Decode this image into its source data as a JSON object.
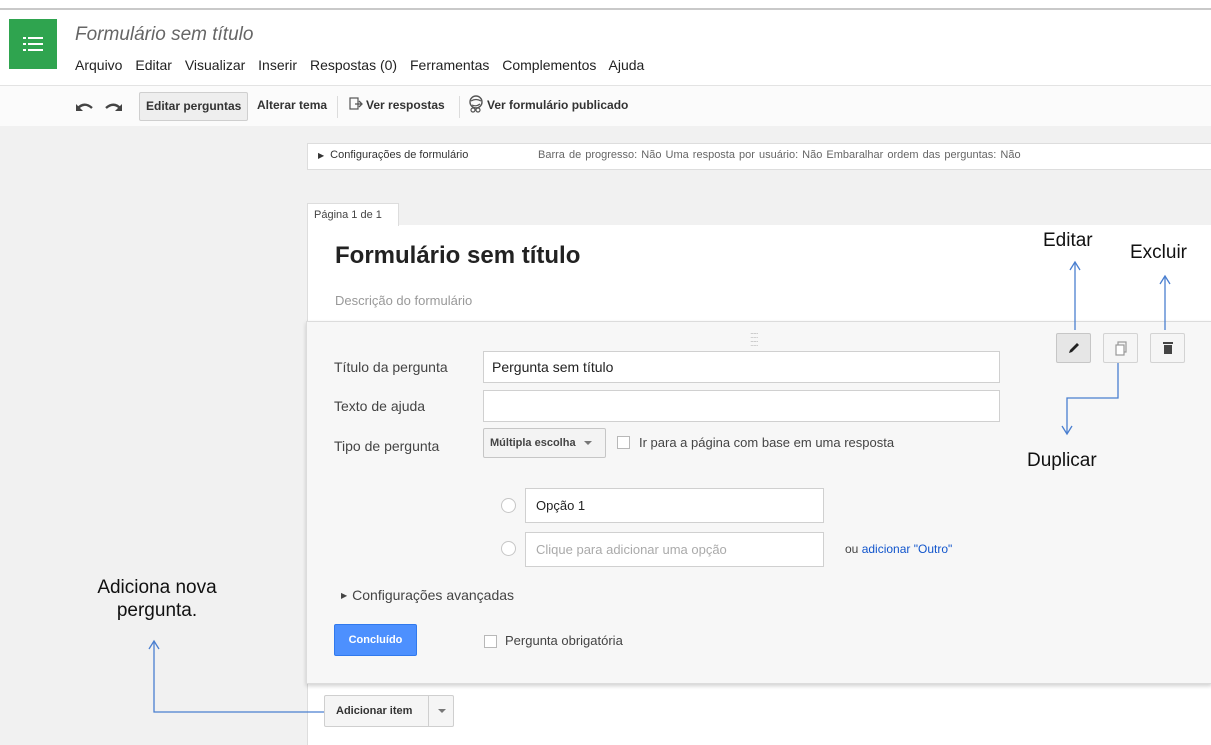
{
  "app": {
    "doc_title": "Formulário sem título",
    "menu": [
      "Arquivo",
      "Editar",
      "Visualizar",
      "Inserir",
      "Respostas (0)",
      "Ferramentas",
      "Complementos",
      "Ajuda"
    ]
  },
  "toolbar": {
    "edit_questions": "Editar perguntas",
    "change_theme": "Alterar tema",
    "view_responses": "Ver respostas",
    "view_published": "Ver formulário publicado"
  },
  "settings": {
    "label": "Configurações de formulário",
    "info": "Barra de progresso: Não   Uma resposta por usuário: Não   Embaralhar ordem das perguntas: Não"
  },
  "page": {
    "tab": "Página 1 de 1",
    "form_title": "Formulário sem título",
    "form_description_placeholder": "Descrição do formulário"
  },
  "question": {
    "title_label": "Título da pergunta",
    "title_value": "Pergunta sem título",
    "help_label": "Texto de ajuda",
    "help_value": "",
    "type_label": "Tipo de pergunta",
    "type_value": "Múltipla escolha",
    "go_to_page_label": "Ir para a página com base em uma resposta",
    "option1": "Opção 1",
    "add_option_placeholder": "Clique para adicionar uma opção",
    "or_text": "ou",
    "add_other": "adicionar \"Outro\"",
    "advanced": "Configurações avançadas",
    "done": "Concluído",
    "required_label": "Pergunta obrigatória"
  },
  "add_item": {
    "label": "Adicionar item"
  },
  "annotations": {
    "edit": "Editar",
    "delete": "Excluir",
    "duplicate": "Duplicar",
    "add_new_line1": "Adiciona nova",
    "add_new_line2": "pergunta."
  },
  "colors": {
    "app_icon": "#2fa44f",
    "primary_button": "#4d90fe",
    "link": "#1155cc",
    "annotation_arrow": "#4a7fd0"
  }
}
